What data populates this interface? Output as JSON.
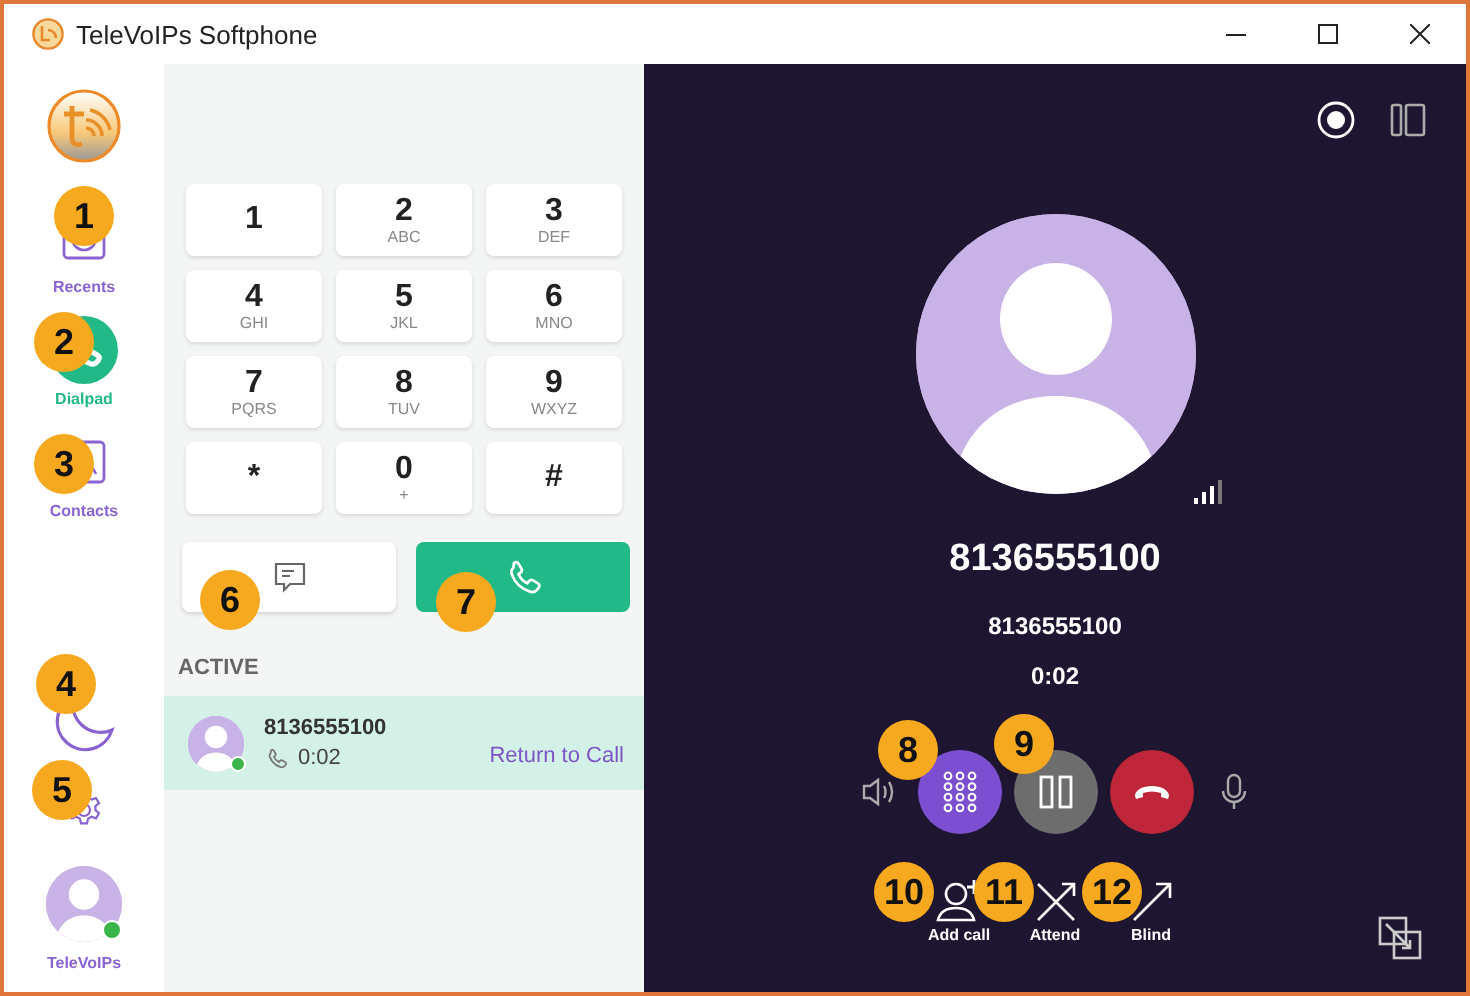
{
  "window": {
    "title": "TeleVoIPs Softphone"
  },
  "sidebar": {
    "items": [
      {
        "kind": "recents",
        "label": "Recents",
        "selected": false
      },
      {
        "kind": "dialpad",
        "label": "Dialpad",
        "selected": true
      },
      {
        "kind": "contacts",
        "label": "Contacts",
        "selected": false
      }
    ],
    "profile": {
      "label": "TeleVoIPs",
      "online": true
    }
  },
  "dialpad": {
    "keys": [
      {
        "digit": "1"
      },
      {
        "digit": "2",
        "letters": "ABC"
      },
      {
        "digit": "3",
        "letters": "DEF"
      },
      {
        "digit": "4",
        "letters": "GHI"
      },
      {
        "digit": "5",
        "letters": "JKL"
      },
      {
        "digit": "6",
        "letters": "MNO"
      },
      {
        "digit": "7",
        "letters": "PQRS"
      },
      {
        "digit": "8",
        "letters": "TUV"
      },
      {
        "digit": "9",
        "letters": "WXYZ"
      },
      {
        "digit": "*"
      },
      {
        "digit": "0",
        "letters": "+"
      },
      {
        "digit": "#"
      }
    ]
  },
  "active": {
    "heading": "ACTIVE",
    "calls": [
      {
        "number": "8136555100",
        "duration": "0:02",
        "action": "Return to Call",
        "online": true
      }
    ]
  },
  "call": {
    "title": "8136555100",
    "number": "8136555100",
    "duration": "0:02",
    "controls": [
      {
        "kind": "speaker"
      },
      {
        "kind": "keypad"
      },
      {
        "kind": "hold"
      },
      {
        "kind": "hangup"
      },
      {
        "kind": "mic"
      }
    ],
    "actions": [
      {
        "kind": "add",
        "label": "Add call"
      },
      {
        "kind": "attend",
        "label": "Attend"
      },
      {
        "kind": "blind",
        "label": "Blind"
      }
    ]
  },
  "callouts": [
    {
      "number": "1"
    },
    {
      "number": "2"
    },
    {
      "number": "3"
    },
    {
      "number": "4"
    },
    {
      "number": "5"
    },
    {
      "number": "6"
    },
    {
      "number": "7"
    },
    {
      "number": "8"
    },
    {
      "number": "9"
    },
    {
      "number": "10"
    },
    {
      "number": "11"
    },
    {
      "number": "12"
    }
  ]
}
